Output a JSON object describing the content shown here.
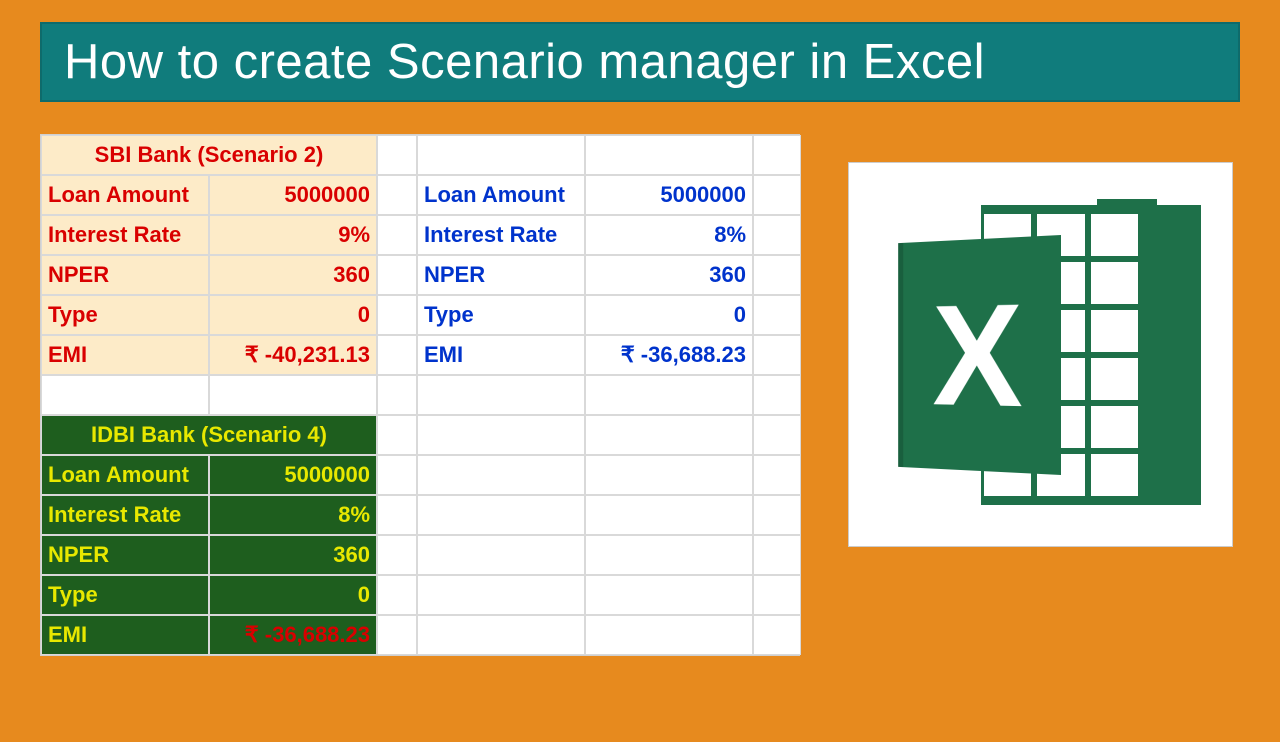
{
  "title": "How to create Scenario manager in Excel",
  "labels": {
    "loan": "Loan Amount",
    "rate": "Interest Rate",
    "nper": "NPER",
    "type": "Type",
    "emi": "EMI"
  },
  "sbi": {
    "header": "SBI Bank (Scenario 2)",
    "loan": "5000000",
    "rate": "9%",
    "nper": "360",
    "type": "0",
    "emi": "₹ -40,231.13"
  },
  "blue": {
    "loan": "5000000",
    "rate": "8%",
    "nper": "360",
    "type": "0",
    "emi": "₹ -36,688.23"
  },
  "idbi": {
    "header": "IDBI Bank (Scenario 4)",
    "loan": "5000000",
    "rate": "8%",
    "nper": "360",
    "type": "0",
    "emi": "₹ -36,688.23"
  },
  "logo_letter": "X"
}
